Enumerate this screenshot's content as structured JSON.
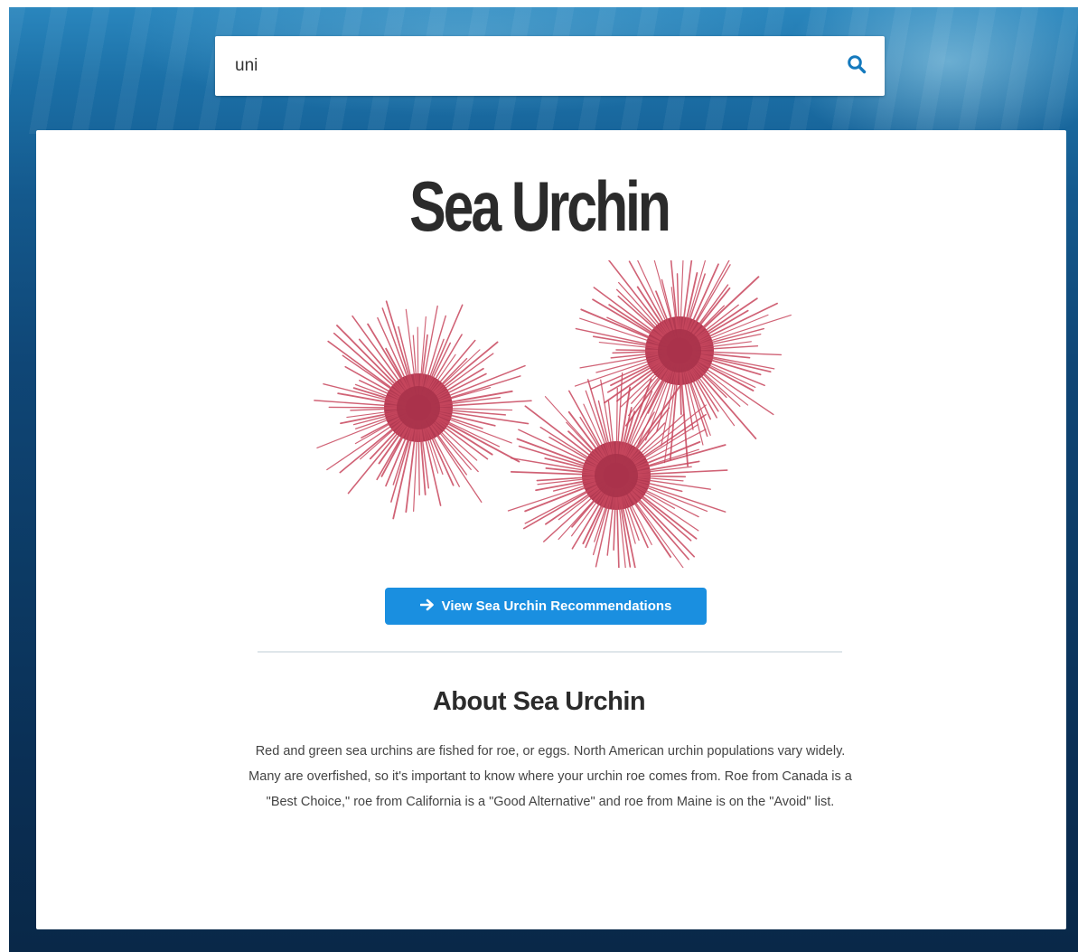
{
  "search": {
    "value": "uni",
    "icon": "search-icon"
  },
  "species": {
    "title": "Sea Urchin",
    "image_icon": "sea-urchin-illustration",
    "cta_label": "View Sea Urchin Recommendations",
    "cta_icon": "arrow-right-icon"
  },
  "about": {
    "heading": "About Sea Urchin",
    "text": "Red and green sea urchins are fished for roe, or eggs. North American urchin populations vary widely. Many are overfished, so it's important to know where your urchin roe comes from. Roe from Canada is a \"Best Choice,\" roe from California is a \"Good Alternative\" and roe from Maine is on the \"Avoid\" list."
  },
  "colors": {
    "accent": "#1a8fe0",
    "search_icon": "#1479bd",
    "urchin": "#c8475e",
    "ocean_top": "#2a86bd",
    "ocean_bottom": "#092848"
  }
}
